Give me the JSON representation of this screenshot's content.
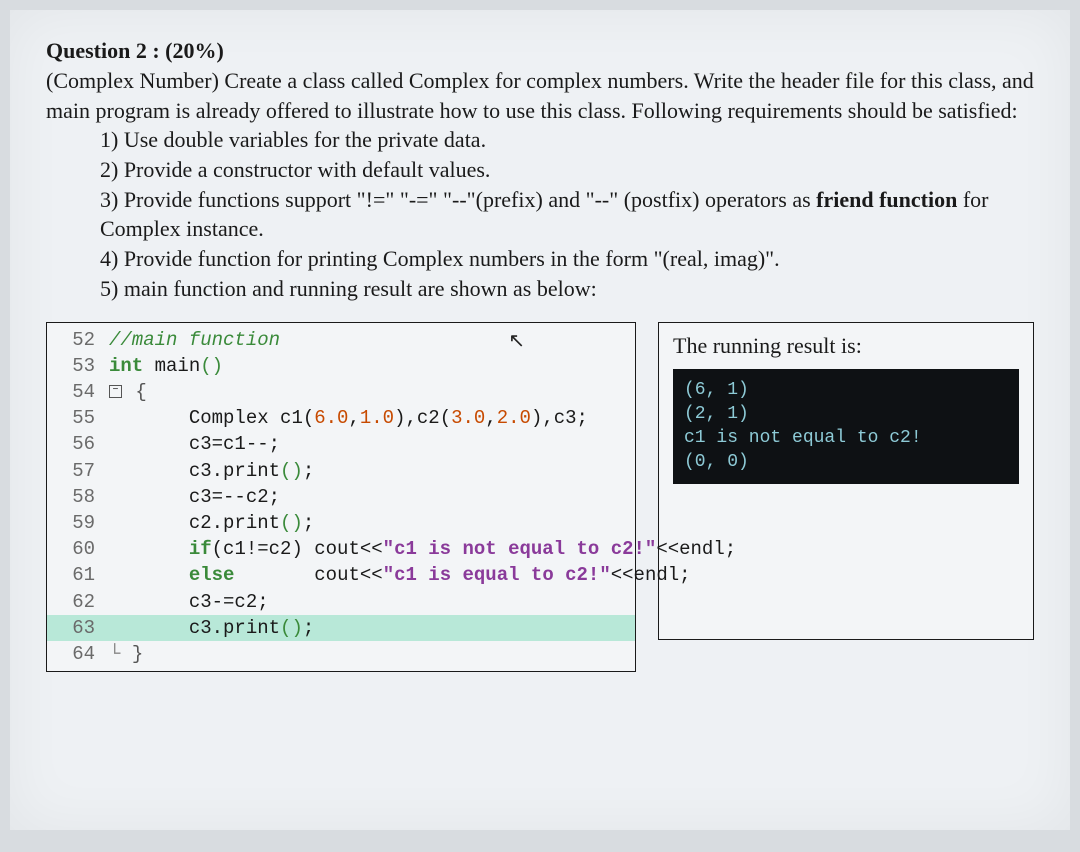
{
  "question": {
    "title": "Question 2 : (20%)",
    "intro": "(Complex Number) Create a class called Complex for complex numbers. Write the header file for this class, and main program is already offered to illustrate how to use this class. Following requirements should be satisfied:",
    "req1": "1) Use double variables for the private data.",
    "req2": "2) Provide a constructor with default values.",
    "req3_a": "3) Provide functions support \"!=\" \"-=\" \"--\"(prefix) and \"--\" (postfix) operators as ",
    "req3_b": "friend function",
    "req3_c": " for Complex instance.",
    "req4": "4) Provide function for printing Complex numbers in the form \"(real, imag)\".",
    "req5": "5) main function and running result are shown as below:"
  },
  "code": {
    "lines": [
      {
        "n": "52",
        "comment": "//main function"
      },
      {
        "n": "53",
        "kw": "int ",
        "fn": "main",
        "p": "()"
      },
      {
        "n": "54",
        "fold": "⊟",
        "brace": "{"
      },
      {
        "n": "55",
        "indent": "       ",
        "text": "Complex c1(",
        "n1": "6.0",
        "c1": ",",
        "n2": "1.0",
        "c2": "),c2(",
        "n3": "3.0",
        "c3": ",",
        "n4": "2.0",
        "c4": "),c3;"
      },
      {
        "n": "56",
        "indent": "       ",
        "text": "c3=c1--;"
      },
      {
        "n": "57",
        "indent": "       ",
        "text": "c3.print",
        "p": "()",
        ";": ";"
      },
      {
        "n": "58",
        "indent": "       ",
        "text": "c3=--c2;"
      },
      {
        "n": "59",
        "indent": "       ",
        "text": "c2.print",
        "p": "()",
        ";": ";"
      },
      {
        "n": "60",
        "indent": "       ",
        "a": "if",
        "b": "(c1!=c2) cout<<",
        "s": "\"c1 is not equal to c2!\"",
        "c": "<<endl;"
      },
      {
        "n": "61",
        "indent": "       ",
        "a": "else",
        "sp": "       ",
        "b": "cout<<",
        "s": "\"c1 is equal to c2!\"",
        "c": "<<endl;"
      },
      {
        "n": "62",
        "indent": "       ",
        "text": "c3-=c2;"
      },
      {
        "n": "63",
        "indent": "       ",
        "text": "c3.print",
        "p": "()",
        ";": ";",
        "hl": true
      },
      {
        "n": "64",
        "fold": "└",
        "brace": "}"
      }
    ]
  },
  "result": {
    "label": "The running result is:",
    "lines": [
      "(6, 1)",
      "(2, 1)",
      "c1 is not equal to c2!",
      "(0, 0)"
    ]
  }
}
